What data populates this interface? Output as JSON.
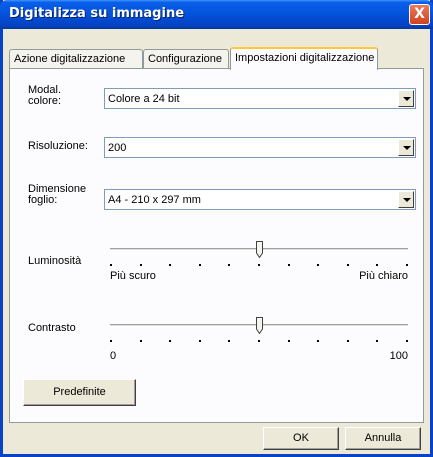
{
  "window": {
    "title": "Digitalizza su immagine",
    "close_glyph": "X"
  },
  "tabs": [
    {
      "label": "Azione digitalizzazione",
      "active": false
    },
    {
      "label": "Configurazione",
      "active": false
    },
    {
      "label": "Impostazioni digitalizzazione",
      "active": true
    }
  ],
  "fields": {
    "color_mode": {
      "label": "Modal.\ncolore:",
      "value": "Colore a 24 bit"
    },
    "resolution": {
      "label": "Risoluzione:",
      "value": "200"
    },
    "paper_size": {
      "label": "Dimensione\nfoglio:",
      "value": "A4 - 210 x 297 mm"
    }
  },
  "brightness": {
    "label": "Luminosità",
    "min_label": "Più scuro",
    "max_label": "Più chiaro",
    "level": 0.5
  },
  "contrast": {
    "label": "Contrasto",
    "min_label": "0",
    "max_label": "100",
    "level": 0.5
  },
  "buttons": {
    "defaults": "Predefinite",
    "ok": "OK",
    "cancel": "Annulla"
  },
  "colors": {
    "titlebar": "#0455e0",
    "face": "#ece9d8",
    "panel": "#fcfcfe",
    "close": "#d2421e"
  }
}
